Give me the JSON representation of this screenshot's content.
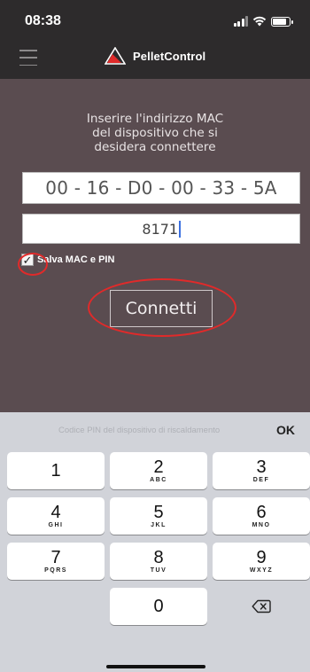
{
  "status": {
    "time": "08:38"
  },
  "app": {
    "name": "PelletControl"
  },
  "colors": {
    "topbar": "#2d2b2c",
    "main_bg": "#5a4c50",
    "accent_red": "#e02a2a",
    "keyboard_bg": "#d1d3d9"
  },
  "form": {
    "instruction": "Inserire l'indirizzo MAC\ndel dispositivo che si\ndesidera connettere",
    "mac_value": "00 - 16 - D0 - 00 - 33 - 5A",
    "pin_value": "8171",
    "save_label": "Salva MAC e PIN",
    "save_checked": true,
    "connect_label": "Connetti"
  },
  "keyboard": {
    "hint": "Codice PIN del dispositivo di riscaldamento",
    "ok_label": "OK",
    "keys": [
      {
        "digit": "1",
        "letters": ""
      },
      {
        "digit": "2",
        "letters": "ABC"
      },
      {
        "digit": "3",
        "letters": "DEF"
      },
      {
        "digit": "4",
        "letters": "GHI"
      },
      {
        "digit": "5",
        "letters": "JKL"
      },
      {
        "digit": "6",
        "letters": "MNO"
      },
      {
        "digit": "7",
        "letters": "PQRS"
      },
      {
        "digit": "8",
        "letters": "TUV"
      },
      {
        "digit": "9",
        "letters": "WXYZ"
      },
      {
        "digit": "0",
        "letters": ""
      }
    ],
    "icons": {
      "delete": "backspace-icon"
    }
  }
}
